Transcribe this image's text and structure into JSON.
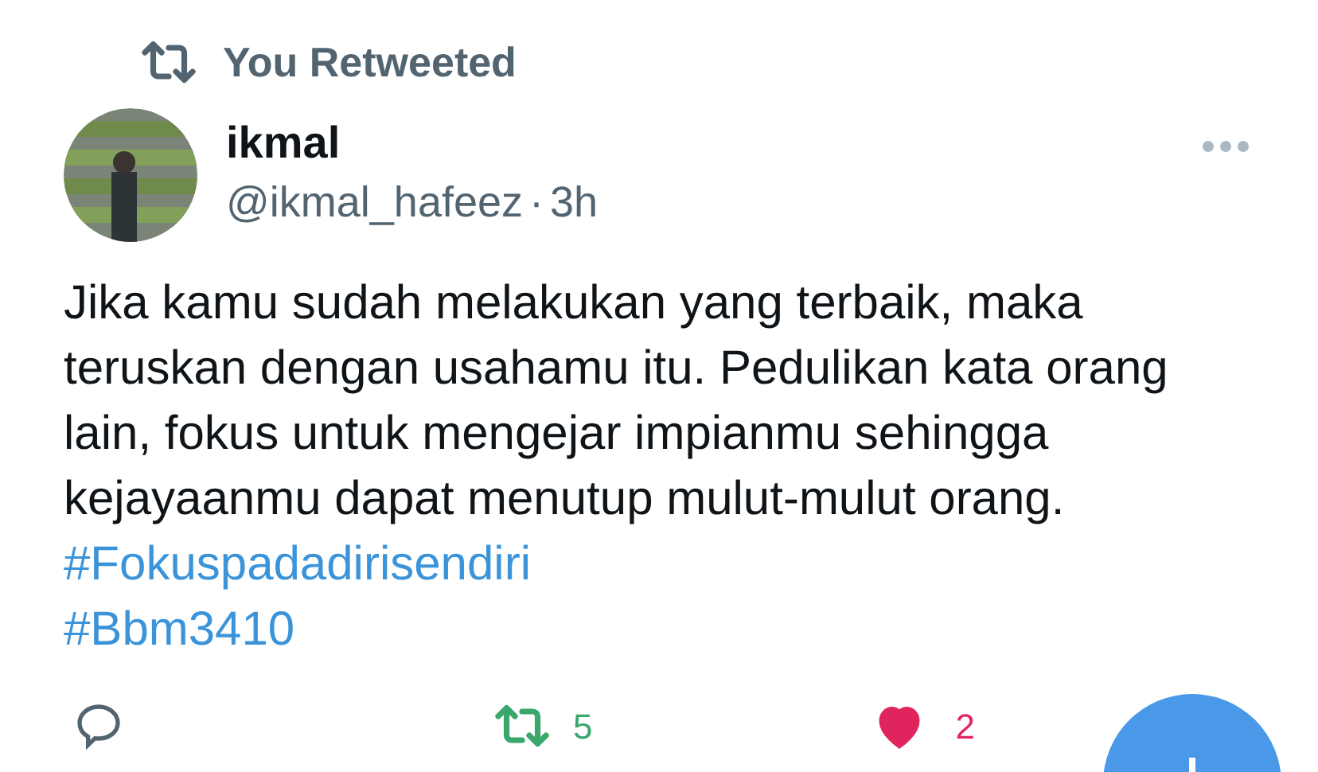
{
  "social_context": "You Retweeted",
  "author": {
    "name": "ikmal",
    "handle": "@ikmal_hafeez",
    "separator": "·",
    "time": "3h"
  },
  "body": "Jika kamu sudah melakukan yang terbaik, maka teruskan dengan usahamu itu. Pedulikan kata orang lain, fokus untuk mengejar impianmu sehingga kejayaanmu dapat menutup mulut-mulut orang.",
  "hashtags": [
    "#Fokuspadadirisendiri",
    "#Bbm3410"
  ],
  "actions": {
    "retweet_count": "5",
    "retweeted": true,
    "like_count": "2",
    "liked": true
  }
}
